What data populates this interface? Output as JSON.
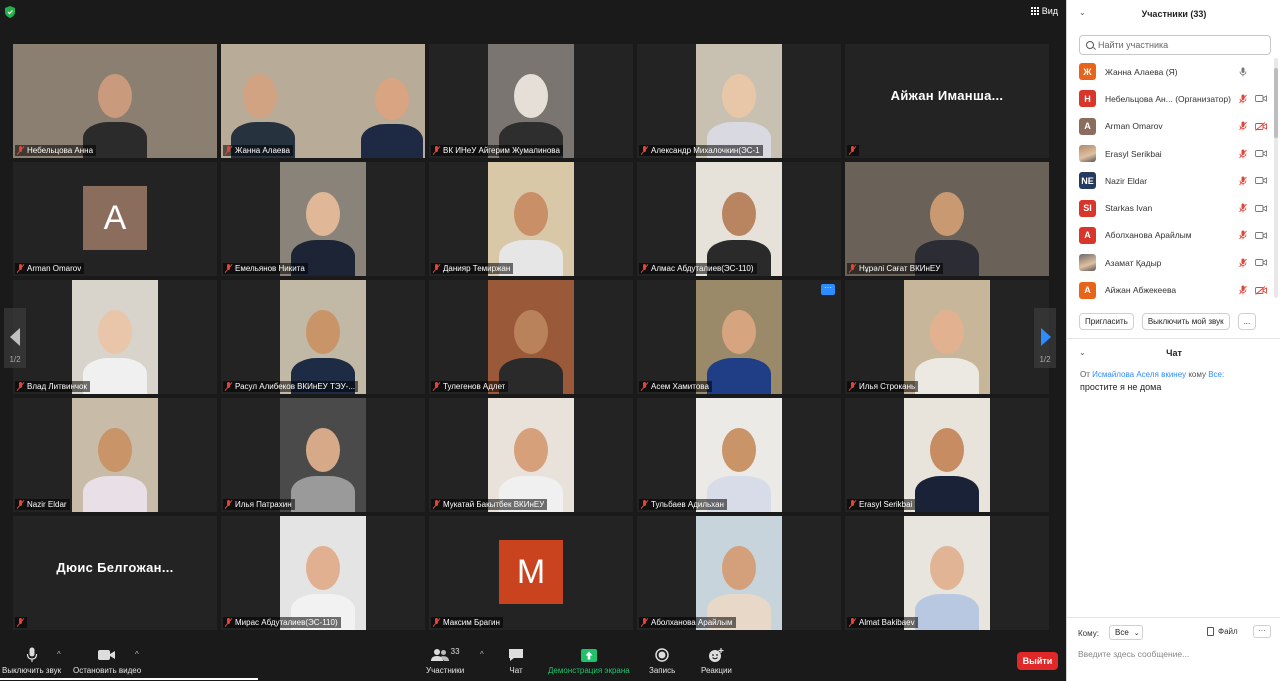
{
  "topbar": {
    "view_label": "Вид"
  },
  "tiles": [
    {
      "name": "Небельцова Анна",
      "bg": "#8a7f70",
      "skin": "#c99a7c",
      "shirt": "#2b2b2b"
    },
    {
      "name": "Жанна Алаева",
      "bg": "#b8ab98",
      "skin": "#d2a382",
      "shirt": "#27323f"
    },
    {
      "name": "ВК ИНеУ Айгерим Жумалинова",
      "bg": "#7a7570",
      "skin": "#e6dfd8",
      "shirt": "#2e2e2e"
    },
    {
      "name": "Александр Михалочкин(ЭС-1",
      "bg": "#c8c0b0",
      "skin": "#e8c7a8",
      "shirt": "#d9d9e2"
    },
    {
      "name": "Айжан Иманша...",
      "name_only": true
    },
    {
      "name": "Arman Omarov",
      "avatar": "A",
      "avatar_bg": "#8b6d5e"
    },
    {
      "name": "Емельянов Никита",
      "bg": "#8a837a",
      "skin": "#e0b898",
      "shirt": "#1c2435"
    },
    {
      "name": "Данияр Темиржан",
      "bg": "#d8c8a8",
      "skin": "#c98f66",
      "shirt": "#e6e6e6"
    },
    {
      "name": "Алмас Абдуталиев(ЭС-110)",
      "bg": "#e6e2da",
      "skin": "#b98560",
      "shirt": "#2a2a2a"
    },
    {
      "name": "Нұрәлі Сағат ВКИнЕУ",
      "bg": "#6a6258",
      "skin": "#c99a72",
      "shirt": "#2c2c34"
    },
    {
      "name": "Влад Литвинчок",
      "bg": "#d8d4cc",
      "skin": "#e9c6aa",
      "shirt": "#f0f0f0"
    },
    {
      "name": "Расул Алибеков ВКИнЕУ ТЭУ-...",
      "bg": "#c2b8a6",
      "skin": "#c99468",
      "shirt": "#1d2b44"
    },
    {
      "name": "Тулегенов Адлет",
      "bg": "#9a5a3a",
      "skin": "#b9825a",
      "shirt": "#2a2a2a"
    },
    {
      "name": "Асем Хамитова",
      "bg": "#9a8a6a",
      "skin": "#d6a47e",
      "shirt": "#1f3e86",
      "more": true
    },
    {
      "name": "Илья Строкань",
      "bg": "#c8b69a",
      "skin": "#e2b290",
      "shirt": "#ece8e2"
    },
    {
      "name": "Nazir Eldar",
      "bg": "#c8bca8",
      "skin": "#c99468",
      "shirt": "#e8e0e6"
    },
    {
      "name": "Илья Патрахин",
      "bg": "#4a4a4a",
      "skin": "#d6aa88",
      "shirt": "#9a9a9a"
    },
    {
      "name": "Мукатай Бакытбек ВКИнЕУ",
      "bg": "#e8e2da",
      "skin": "#d6a07a",
      "shirt": "#f0f0f0"
    },
    {
      "name": "Тульбаев Адильхан",
      "bg": "#eceae6",
      "skin": "#c99468",
      "shirt": "#d8dce8"
    },
    {
      "name": "Erasyl Serikbai",
      "bg": "#e8e4dc",
      "skin": "#c78c62",
      "shirt": "#1a2238"
    },
    {
      "name": "Дюис Белгожан...",
      "name_only": true
    },
    {
      "name": "Мирас Абдуталиев(ЭС-110)",
      "bg": "#e4e4e4",
      "skin": "#e0b090",
      "shirt": "#f2f2f2"
    },
    {
      "name": "Максим Брагин",
      "avatar": "M",
      "avatar_bg": "#c9431f"
    },
    {
      "name": "Аболханова Арайлым",
      "bg": "#c8d4dc",
      "skin": "#d4a07c",
      "shirt": "#e8d8c8"
    },
    {
      "name": "Almat Bakibaev",
      "bg": "#e8e4de",
      "skin": "#e2b496",
      "shirt": "#b8c8e0"
    }
  ],
  "pagination": {
    "left": "1/2",
    "right": "1/2"
  },
  "toolbar": {
    "mute_label": "Выключить звук",
    "video_label": "Остановить видео",
    "participants_label": "Участники",
    "participants_count": "33",
    "chat_label": "Чат",
    "share_label": "Демонстрация экрана",
    "record_label": "Запись",
    "reactions_label": "Реакции",
    "leave_label": "Выйти"
  },
  "panel": {
    "title": "Участники (33)",
    "search_placeholder": "Найти участника",
    "participants": [
      {
        "initial": "Ж",
        "name": "Жанна Алаева (Я)",
        "color": "#e8641a",
        "mic": "on",
        "cam": "none"
      },
      {
        "initial": "Н",
        "name": "Небельцова Ан...  (Организатор)",
        "color": "#d9362b",
        "mic": "muted",
        "cam": "on"
      },
      {
        "initial": "A",
        "name": "Arman Omarov",
        "color": "#8b6d5e",
        "mic": "muted",
        "cam": "off"
      },
      {
        "initial": "",
        "name": "Erasyl Serikbai",
        "color": "#b08a6a",
        "mic": "muted",
        "cam": "on",
        "photo": true
      },
      {
        "initial": "NE",
        "name": "Nazir Eldar",
        "color": "#243a5e",
        "mic": "muted",
        "cam": "on"
      },
      {
        "initial": "SI",
        "name": "Starkas Ivan",
        "color": "#d9362b",
        "mic": "muted",
        "cam": "on"
      },
      {
        "initial": "А",
        "name": "Аболханова Арайлым",
        "color": "#d9362b",
        "mic": "muted",
        "cam": "on"
      },
      {
        "initial": "",
        "name": "Азамат Қадыр",
        "color": "#6a6a6a",
        "mic": "muted",
        "cam": "on",
        "photo": true
      },
      {
        "initial": "А",
        "name": "Айжан Абжекеева",
        "color": "#e8641a",
        "mic": "muted",
        "cam": "off"
      }
    ],
    "invite_label": "Пригласить",
    "mute_me_label": "Выключить мой звук",
    "more_label": "...",
    "chat_title": "Чат",
    "chat": {
      "from_prefix": "От",
      "sender": "Исмайлова Аселя вкинеу",
      "to_prefix": "кому",
      "recipient": "Все:",
      "message": "простите я не дома"
    },
    "to_label": "Кому:",
    "to_value": "Все",
    "file_label": "Файл",
    "message_placeholder": "Введите здесь сообщение..."
  }
}
